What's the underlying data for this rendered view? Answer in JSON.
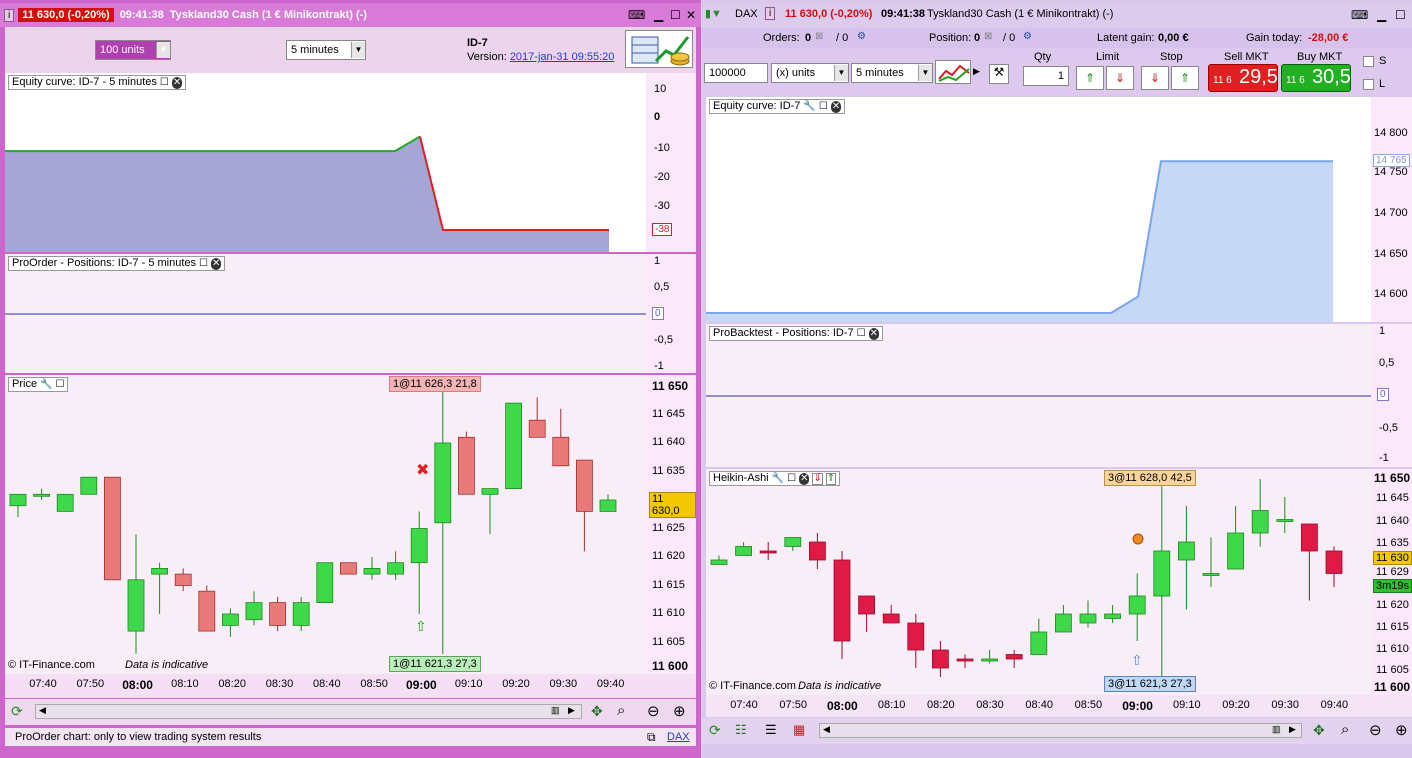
{
  "left": {
    "titlebar": {
      "badge": "i",
      "price": "11 630,0 (-0,20%)",
      "time": "09:41:38",
      "instrument": "Tyskland30 Cash (1 € Minikontrakt) (-)"
    },
    "toolbar": {
      "units": "100 units",
      "timeframe": "5 minutes",
      "system_name": "ID-7",
      "version_label": "Version:",
      "version_date": "2017-jan-31 09:55:20"
    },
    "equity": {
      "title": "Equity curve: ID-7 - 5 minutes",
      "yticks": [
        "10",
        "0",
        "-10",
        "-20",
        "-30"
      ],
      "last_label": "-38"
    },
    "positions": {
      "title": "ProOrder - Positions: ID-7 - 5 minutes",
      "yticks": [
        "1",
        "0,5",
        "0",
        "-0,5",
        "-1"
      ]
    },
    "price": {
      "title": "Price",
      "yticks": [
        "11 650",
        "11 645",
        "11 640",
        "11 635",
        "11 630,0",
        "11 625",
        "11 620",
        "11 615",
        "11 610",
        "11 605",
        "11 600"
      ],
      "top_chip": "1@11 626,3 21,8",
      "bottom_chip": "1@11 621,3 27,3",
      "copyright": "© IT-Finance.com",
      "disclaimer": "Data is indicative"
    },
    "xticks": [
      "07:40",
      "07:50",
      "08:00",
      "08:10",
      "08:20",
      "08:30",
      "08:40",
      "08:50",
      "09:00",
      "09:10",
      "09:20",
      "09:30",
      "09:40"
    ],
    "status": {
      "text": "ProOrder chart: only to view trading system results",
      "link": "DAX"
    }
  },
  "right": {
    "titlebar": {
      "symbol": "DAX",
      "badge": "i",
      "price": "11 630,0 (-0,20%)",
      "time": "09:41:38",
      "instrument": "Tyskland30 Cash (1 € Minikontrakt) (-)"
    },
    "account": {
      "orders_label": "Orders:",
      "orders_value": "0",
      "orders_value2": "/ 0",
      "position_label": "Position:",
      "position_value": "0",
      "position_value2": "/ 0",
      "latent_label": "Latent gain:",
      "latent_value": "0,00 €",
      "gain_label": "Gain today:",
      "gain_value": "-28,00 €"
    },
    "ticket": {
      "capital": "100000",
      "units": "(x) units",
      "timeframe": "5 minutes",
      "qty_label": "Qty",
      "qty_value": "1",
      "limit_label": "Limit",
      "stop_label": "Stop",
      "sell_label": "Sell MKT",
      "buy_label": "Buy MKT",
      "sell_small": "11 6",
      "sell_big": "29,5",
      "buy_small": "11 6",
      "buy_big": "30,5",
      "s_label": "S",
      "l_label": "L"
    },
    "equity": {
      "title": "Equity curve: ID-7",
      "yticks": [
        "14 800",
        "14 750",
        "14 700",
        "14 650",
        "14 600"
      ],
      "last_label": "14 765"
    },
    "positions": {
      "title": "ProBacktest - Positions: ID-7",
      "yticks": [
        "1",
        "0,5",
        "0",
        "-0,5",
        "-1"
      ]
    },
    "ha": {
      "title": "Heikin-Ashi",
      "yticks": [
        "11 650",
        "11 645",
        "11 640",
        "11 635",
        "11 630",
        "11 629",
        "11 620",
        "11 615",
        "11 610",
        "11 605",
        "11 600"
      ],
      "countdown": "3m19s",
      "top_chip": "3@11 628,0 42,5",
      "bottom_chip": "3@11 621,3 27,3",
      "copyright": "© IT-Finance.com",
      "disclaimer": "Data is indicative"
    },
    "xticks": [
      "07:40",
      "07:50",
      "08:00",
      "08:10",
      "08:20",
      "08:30",
      "08:40",
      "08:50",
      "09:00",
      "09:10",
      "09:20",
      "09:30",
      "09:40"
    ]
  },
  "colors": {
    "up": "#3fd84b",
    "down_left": "#e87a7a",
    "down_right": "#e01a46",
    "equity_fill_left": "#a5a6d6",
    "equity_fill_right": "#c6d8f6",
    "zero_line": "#3030b0"
  },
  "chart_data": [
    {
      "type": "area",
      "title": "Equity curve: ID-7 - 5 minutes",
      "ylim": [
        -40,
        10
      ],
      "x": [
        "07:35",
        "08:55",
        "09:00",
        "09:05",
        "09:35"
      ],
      "y": [
        -11,
        -11,
        -6,
        -38,
        -38
      ]
    },
    {
      "type": "bar",
      "title": "Price",
      "ylim": [
        11600,
        11650
      ],
      "candles_ohlc": [
        [
          11629,
          11631,
          11627,
          11631
        ],
        [
          11631,
          11632,
          11630,
          11631
        ],
        [
          11628,
          11631,
          11628,
          11631
        ],
        [
          11631,
          11634,
          11631,
          11634
        ],
        [
          11634,
          11634,
          11616,
          11616
        ],
        [
          11607,
          11624,
          11603,
          11616
        ],
        [
          11617,
          11619,
          11610,
          11618
        ],
        [
          11617,
          11618,
          11614,
          11615
        ],
        [
          11614,
          11615,
          11607,
          11607
        ],
        [
          11608,
          11611,
          11606,
          11610
        ],
        [
          11609,
          11614,
          11608,
          11612
        ],
        [
          11612,
          11613,
          11607,
          11608
        ],
        [
          11608,
          11613,
          11607,
          11612
        ],
        [
          11612,
          11619,
          11612,
          11619
        ],
        [
          11619,
          11619,
          11617,
          11617
        ],
        [
          11617,
          11620,
          11616,
          11618
        ],
        [
          11617,
          11621,
          11616,
          11619
        ],
        [
          11619,
          11628,
          11610,
          11625
        ],
        [
          11626,
          11649,
          11603,
          11640
        ],
        [
          11641,
          11642,
          11631,
          11631
        ],
        [
          11631,
          11632,
          11624,
          11632
        ],
        [
          11632,
          11647,
          11632,
          11647
        ],
        [
          11644,
          11648,
          11641,
          11641
        ],
        [
          11641,
          11646,
          11636,
          11636
        ],
        [
          11637,
          11637,
          11621,
          11628
        ],
        [
          11628,
          11631,
          11628,
          11630
        ]
      ]
    },
    {
      "type": "area",
      "title": "Equity curve: ID-7",
      "ylim": [
        14580,
        14820
      ],
      "x": [
        "07:35",
        "08:50",
        "09:00",
        "09:05",
        "09:40"
      ],
      "y": [
        14580,
        14580,
        14600,
        14765,
        14765
      ]
    }
  ]
}
